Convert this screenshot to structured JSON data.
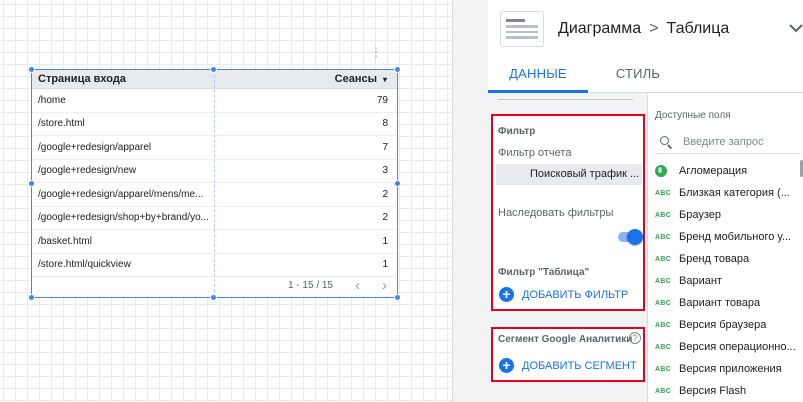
{
  "table": {
    "header": {
      "page": "Страница входа",
      "sessions": "Сеансы",
      "sort_icon": "▾"
    },
    "rows": [
      {
        "page": "/home",
        "sessions": "79"
      },
      {
        "page": "/store.html",
        "sessions": "8"
      },
      {
        "page": "/google+redesign/apparel",
        "sessions": "7"
      },
      {
        "page": "/google+redesign/new",
        "sessions": "3"
      },
      {
        "page": "/google+redesign/apparel/mens/me...",
        "sessions": "2"
      },
      {
        "page": "/google+redesign/shop+by+brand/yo...",
        "sessions": "2"
      },
      {
        "page": "/basket.html",
        "sessions": "1"
      },
      {
        "page": "/store.html/quickview",
        "sessions": "1"
      }
    ],
    "pagination": {
      "range": "1 - 15 / 15",
      "prev": "‹",
      "next": "›"
    }
  },
  "panel": {
    "breadcrumb": {
      "parent": "Диаграмма",
      "separator": ">",
      "current": "Таблица"
    },
    "collapse_icon": "chevron-down-icon",
    "tabs": [
      {
        "label": "ДАННЫЕ",
        "active": true
      },
      {
        "label": "СТИЛЬ",
        "active": false
      }
    ],
    "filter": {
      "title": "Фильтр",
      "report_filter_label": "Фильтр отчета",
      "report_filter_value": "Поисковый трафик ...",
      "inherit_label": "Наследовать фильтры",
      "inherit_enabled": true,
      "table_filter_label": "Фильтр \"Таблица\"",
      "add_filter": "ДОБАВИТЬ ФИЛЬТР"
    },
    "segment": {
      "title": "Сегмент Google Аналитики",
      "add_segment": "ДОБАВИТЬ СЕГМЕНТ",
      "help_icon": "help-icon"
    },
    "fields": {
      "title": "Доступные поля",
      "search_placeholder": "Введите запрос",
      "items": [
        {
          "type": "geo",
          "label": "Агломерация"
        },
        {
          "type": "ABC",
          "label": "Близкая категория (..."
        },
        {
          "type": "ABC",
          "label": "Браузер"
        },
        {
          "type": "ABC",
          "label": "Бренд мобильного у..."
        },
        {
          "type": "ABC",
          "label": "Бренд товара"
        },
        {
          "type": "ABC",
          "label": "Вариант"
        },
        {
          "type": "ABC",
          "label": "Вариант товара"
        },
        {
          "type": "ABC",
          "label": "Версия браузера"
        },
        {
          "type": "ABC",
          "label": "Версия операционно..."
        },
        {
          "type": "ABC",
          "label": "Версия приложения"
        },
        {
          "type": "ABC",
          "label": "Версия Flash"
        }
      ]
    }
  },
  "colors": {
    "accent": "#1a73e8",
    "highlight_box": "#e8001f",
    "dimension_green": "#34a853"
  }
}
